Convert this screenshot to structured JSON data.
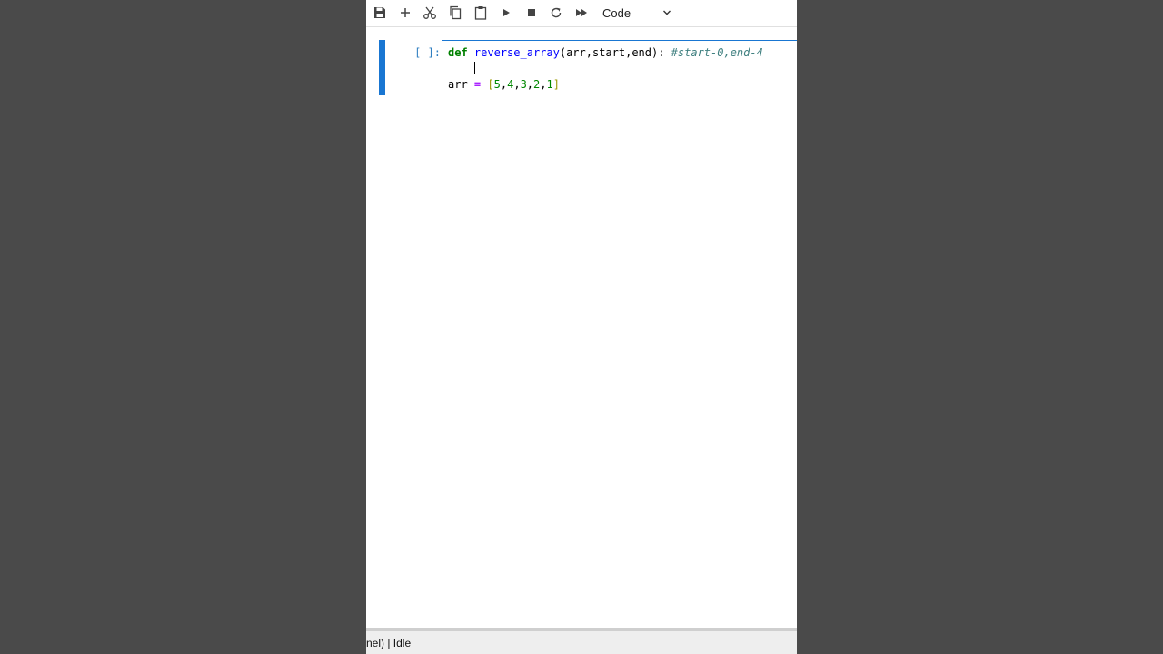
{
  "toolbar": {
    "buttons": [
      {
        "name": "save",
        "icon": "save-icon"
      },
      {
        "name": "insert-cell",
        "icon": "plus-icon"
      },
      {
        "name": "cut",
        "icon": "scissors-icon"
      },
      {
        "name": "copy",
        "icon": "copy-icon"
      },
      {
        "name": "paste",
        "icon": "paste-icon"
      },
      {
        "name": "run",
        "icon": "play-icon"
      },
      {
        "name": "interrupt",
        "icon": "stop-icon"
      },
      {
        "name": "restart",
        "icon": "restart-icon"
      },
      {
        "name": "run-all",
        "icon": "fast-forward-icon"
      }
    ],
    "cell_type": "Code"
  },
  "cell": {
    "prompt": "[ ]:",
    "code": {
      "line1": {
        "keyword": "def",
        "function": "reverse_array",
        "params": "(arr,start,end):",
        "comment": "#start-0,end-4"
      },
      "line3": {
        "var": "arr",
        "op": "=",
        "open": "[",
        "n1": "5",
        "n2": "4",
        "n3": "3",
        "n4": "2",
        "n5": "1",
        "comma": ",",
        "close": "]"
      }
    }
  },
  "status": {
    "text": "nel) | Idle"
  },
  "colors": {
    "accent": "#1976d2",
    "keyword": "#008000",
    "function": "#0000ff",
    "comment": "#408080",
    "operator": "#aa22ff",
    "number": "#008800",
    "background_outside": "#4a4a4a"
  }
}
